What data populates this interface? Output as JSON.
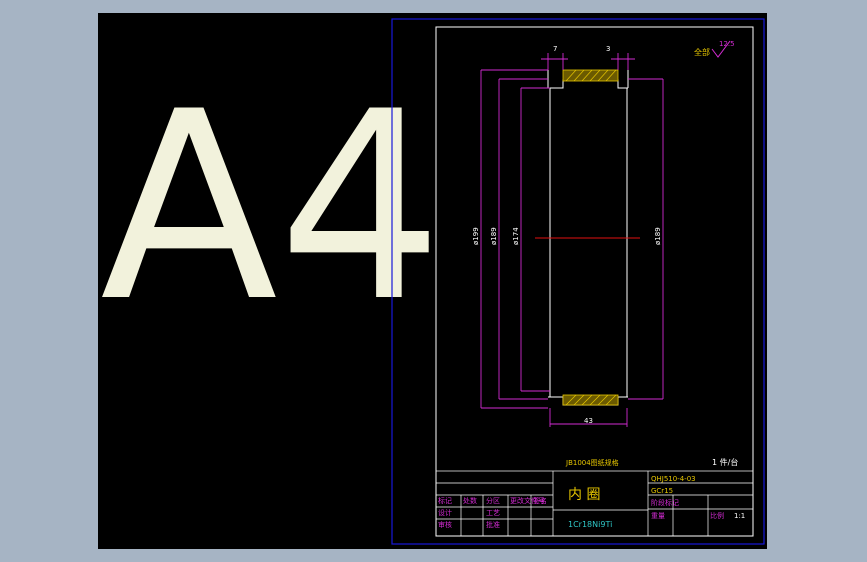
{
  "sheet": {
    "size_mark": "A4",
    "title_symbol": "全部",
    "roughness": "12.5"
  },
  "dimensions": {
    "width_left": "7",
    "width_right": "3",
    "dia_outer": "ø199",
    "dia_2": "ø189",
    "dia_3": "ø174",
    "dia_right": "ø189",
    "length": "43"
  },
  "title_block": {
    "drawing_note": "JB1004图纸规格",
    "quantity": "1 件/台",
    "part_name": "内 圈",
    "drawing_no": "QHJ510-4-03",
    "material_code": "GCr15",
    "material": "1Cr18Ni9Ti",
    "scale": "1:1",
    "headers": [
      "标记",
      "处数",
      "分区",
      "更改文件号",
      "签名",
      "年月日"
    ],
    "rows": [
      "设计",
      "审核",
      "工艺",
      "批准"
    ],
    "right_labels": [
      "阶段标记",
      "重量",
      "比例"
    ]
  },
  "colors": {
    "border": "#1818d8",
    "frame": "#ffffff",
    "dimension": "#d22bd2",
    "centerline": "#e01010",
    "hatch": "#e6c600",
    "big_letters": "#f2f2dc"
  }
}
